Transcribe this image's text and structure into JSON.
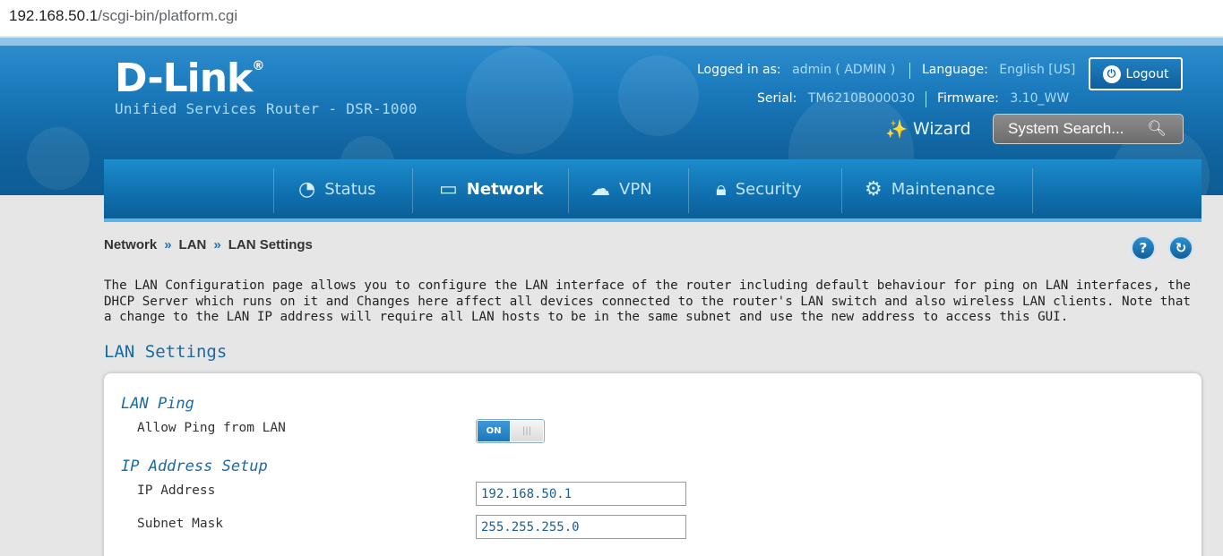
{
  "browser": {
    "url_host": "192.168.50.1",
    "url_path": "/scgi-bin/platform.cgi"
  },
  "header": {
    "logo": "D-Link",
    "logo_mark": "®",
    "model": "Unified Services Router - DSR-1000",
    "logged_in_label": "Logged in as:",
    "user": "admin ( ADMIN )",
    "language_label": "Language:",
    "language": "English [US]",
    "serial_label": "Serial:",
    "serial": "TM6210B000030",
    "firmware_label": "Firmware:",
    "firmware": "3.10_WW",
    "logout_label": "Logout",
    "wizard_label": "Wizard",
    "search_placeholder": "System Search..."
  },
  "nav": {
    "items": [
      {
        "label": "Status",
        "icon": "gauge-icon"
      },
      {
        "label": "Network",
        "icon": "monitor-icon",
        "active": true
      },
      {
        "label": "VPN",
        "icon": "cloud-lock-icon"
      },
      {
        "label": "Security",
        "icon": "lock-icon"
      },
      {
        "label": "Maintenance",
        "icon": "gears-icon"
      }
    ]
  },
  "breadcrumb": {
    "items": [
      "Network",
      "LAN",
      "LAN Settings"
    ],
    "separator": "»"
  },
  "page": {
    "description": "The LAN Configuration page allows you to configure the LAN interface of the router including default behaviour for ping on LAN interfaces, the DHCP Server which runs on it and Changes here affect all devices connected to the router's LAN switch and also wireless LAN clients. Note that a change to the LAN IP address will require all LAN hosts to be in the same subnet and use the new address to access this GUI.",
    "section_title": "LAN Settings",
    "help_icon": "?",
    "refresh_icon": "↻"
  },
  "form": {
    "lan_ping_group": "LAN Ping",
    "allow_ping_label": "Allow Ping from LAN",
    "allow_ping_state": "ON",
    "ip_setup_group": "IP Address Setup",
    "ip_address_label": "IP Address",
    "ip_address_value": "192.168.50.1",
    "subnet_mask_label": "Subnet Mask",
    "subnet_mask_value": "255.255.255.0"
  }
}
